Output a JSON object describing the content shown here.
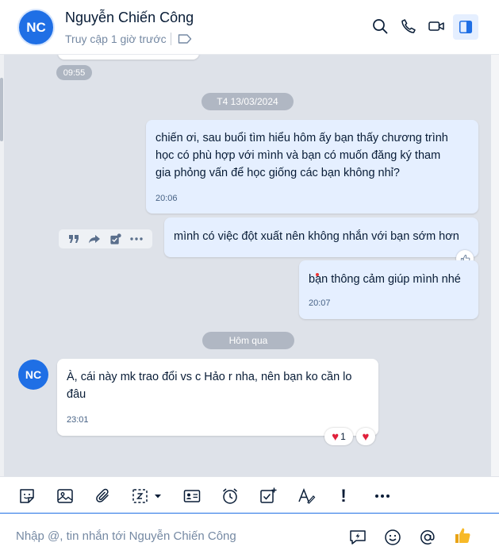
{
  "header": {
    "avatar_initials": "NC",
    "contact_name": "Nguyễn Chiến Công",
    "status": "Truy cập 1 giờ trước",
    "icons": [
      "search-icon",
      "phone-icon",
      "video-icon",
      "sidebar-icon"
    ]
  },
  "conversation": {
    "prev_time": "09:55",
    "date_sep_1": "T4 13/03/2024",
    "date_sep_2": "Hôm qua",
    "messages": [
      {
        "sender": "me",
        "lines": [
          "chiến ơi, sau buổi tìm hiểu hôm ấy bạn thấy chương trình",
          "học có phù hợp với mình và bạn có muốn đăng ký tham",
          "gia phỏng vấn để học giống các bạn không nhỉ?"
        ],
        "time": "20:06"
      },
      {
        "sender": "me",
        "lines": [
          "mình có việc đột xuất nên không nhắn với bạn sớm hơn"
        ]
      },
      {
        "sender": "me",
        "lines": [
          "bạn thông cảm giúp mình nhé"
        ],
        "time": "20:07"
      },
      {
        "sender": "contact",
        "avatar_initials": "NC",
        "lines": [
          " À, cái này mk trao đổi vs c Hảo r nha, nên bạn ko cần lo",
          "đâu"
        ],
        "time": "23:01",
        "reaction_count": "1"
      }
    ]
  },
  "composer": {
    "placeholder": "Nhập @, tin nhắn tới Nguyễn Chiến Công"
  },
  "colors": {
    "accent": "#1f6fe5",
    "chat_bg": "#dee2e9",
    "my_bubble": "#e5efff",
    "their_bubble": "#ffffff",
    "heart": "#e0203b"
  }
}
